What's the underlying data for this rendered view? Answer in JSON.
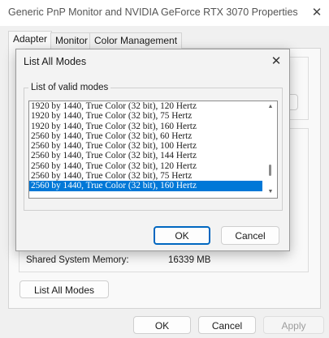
{
  "window": {
    "title": "Generic PnP Monitor and NVIDIA GeForce RTX 3070 Properties",
    "close_glyph": "✕"
  },
  "tabs": [
    {
      "label": "Adapter",
      "active": true
    },
    {
      "label": "Monitor",
      "active": false
    },
    {
      "label": "Color Management",
      "active": false
    }
  ],
  "adapter": {
    "shared_memory_label": "Shared System Memory:",
    "shared_memory_value": "16339 MB",
    "list_all_modes_label": "List All Modes"
  },
  "footer": {
    "ok_label": "OK",
    "cancel_label": "Cancel",
    "apply_label": "Apply"
  },
  "dialog": {
    "title": "List All Modes",
    "close_glyph": "✕",
    "group_label": "List of valid modes",
    "modes": [
      "1920 by 1440, True Color (32 bit), 120 Hertz",
      "1920 by 1440, True Color (32 bit), 75 Hertz",
      "1920 by 1440, True Color (32 bit), 160 Hertz",
      "2560 by 1440, True Color (32 bit), 60 Hertz",
      "2560 by 1440, True Color (32 bit), 100 Hertz",
      "2560 by 1440, True Color (32 bit), 144 Hertz",
      "2560 by 1440, True Color (32 bit), 120 Hertz",
      "2560 by 1440, True Color (32 bit), 75 Hertz",
      "2560 by 1440, True Color (32 bit), 160 Hertz"
    ],
    "selected_index": 8,
    "ok_label": "OK",
    "cancel_label": "Cancel",
    "scroll_up_glyph": "▲",
    "scroll_down_glyph": "▼"
  },
  "colors": {
    "selection": "#0078d7",
    "primary_border": "#0067c0"
  }
}
